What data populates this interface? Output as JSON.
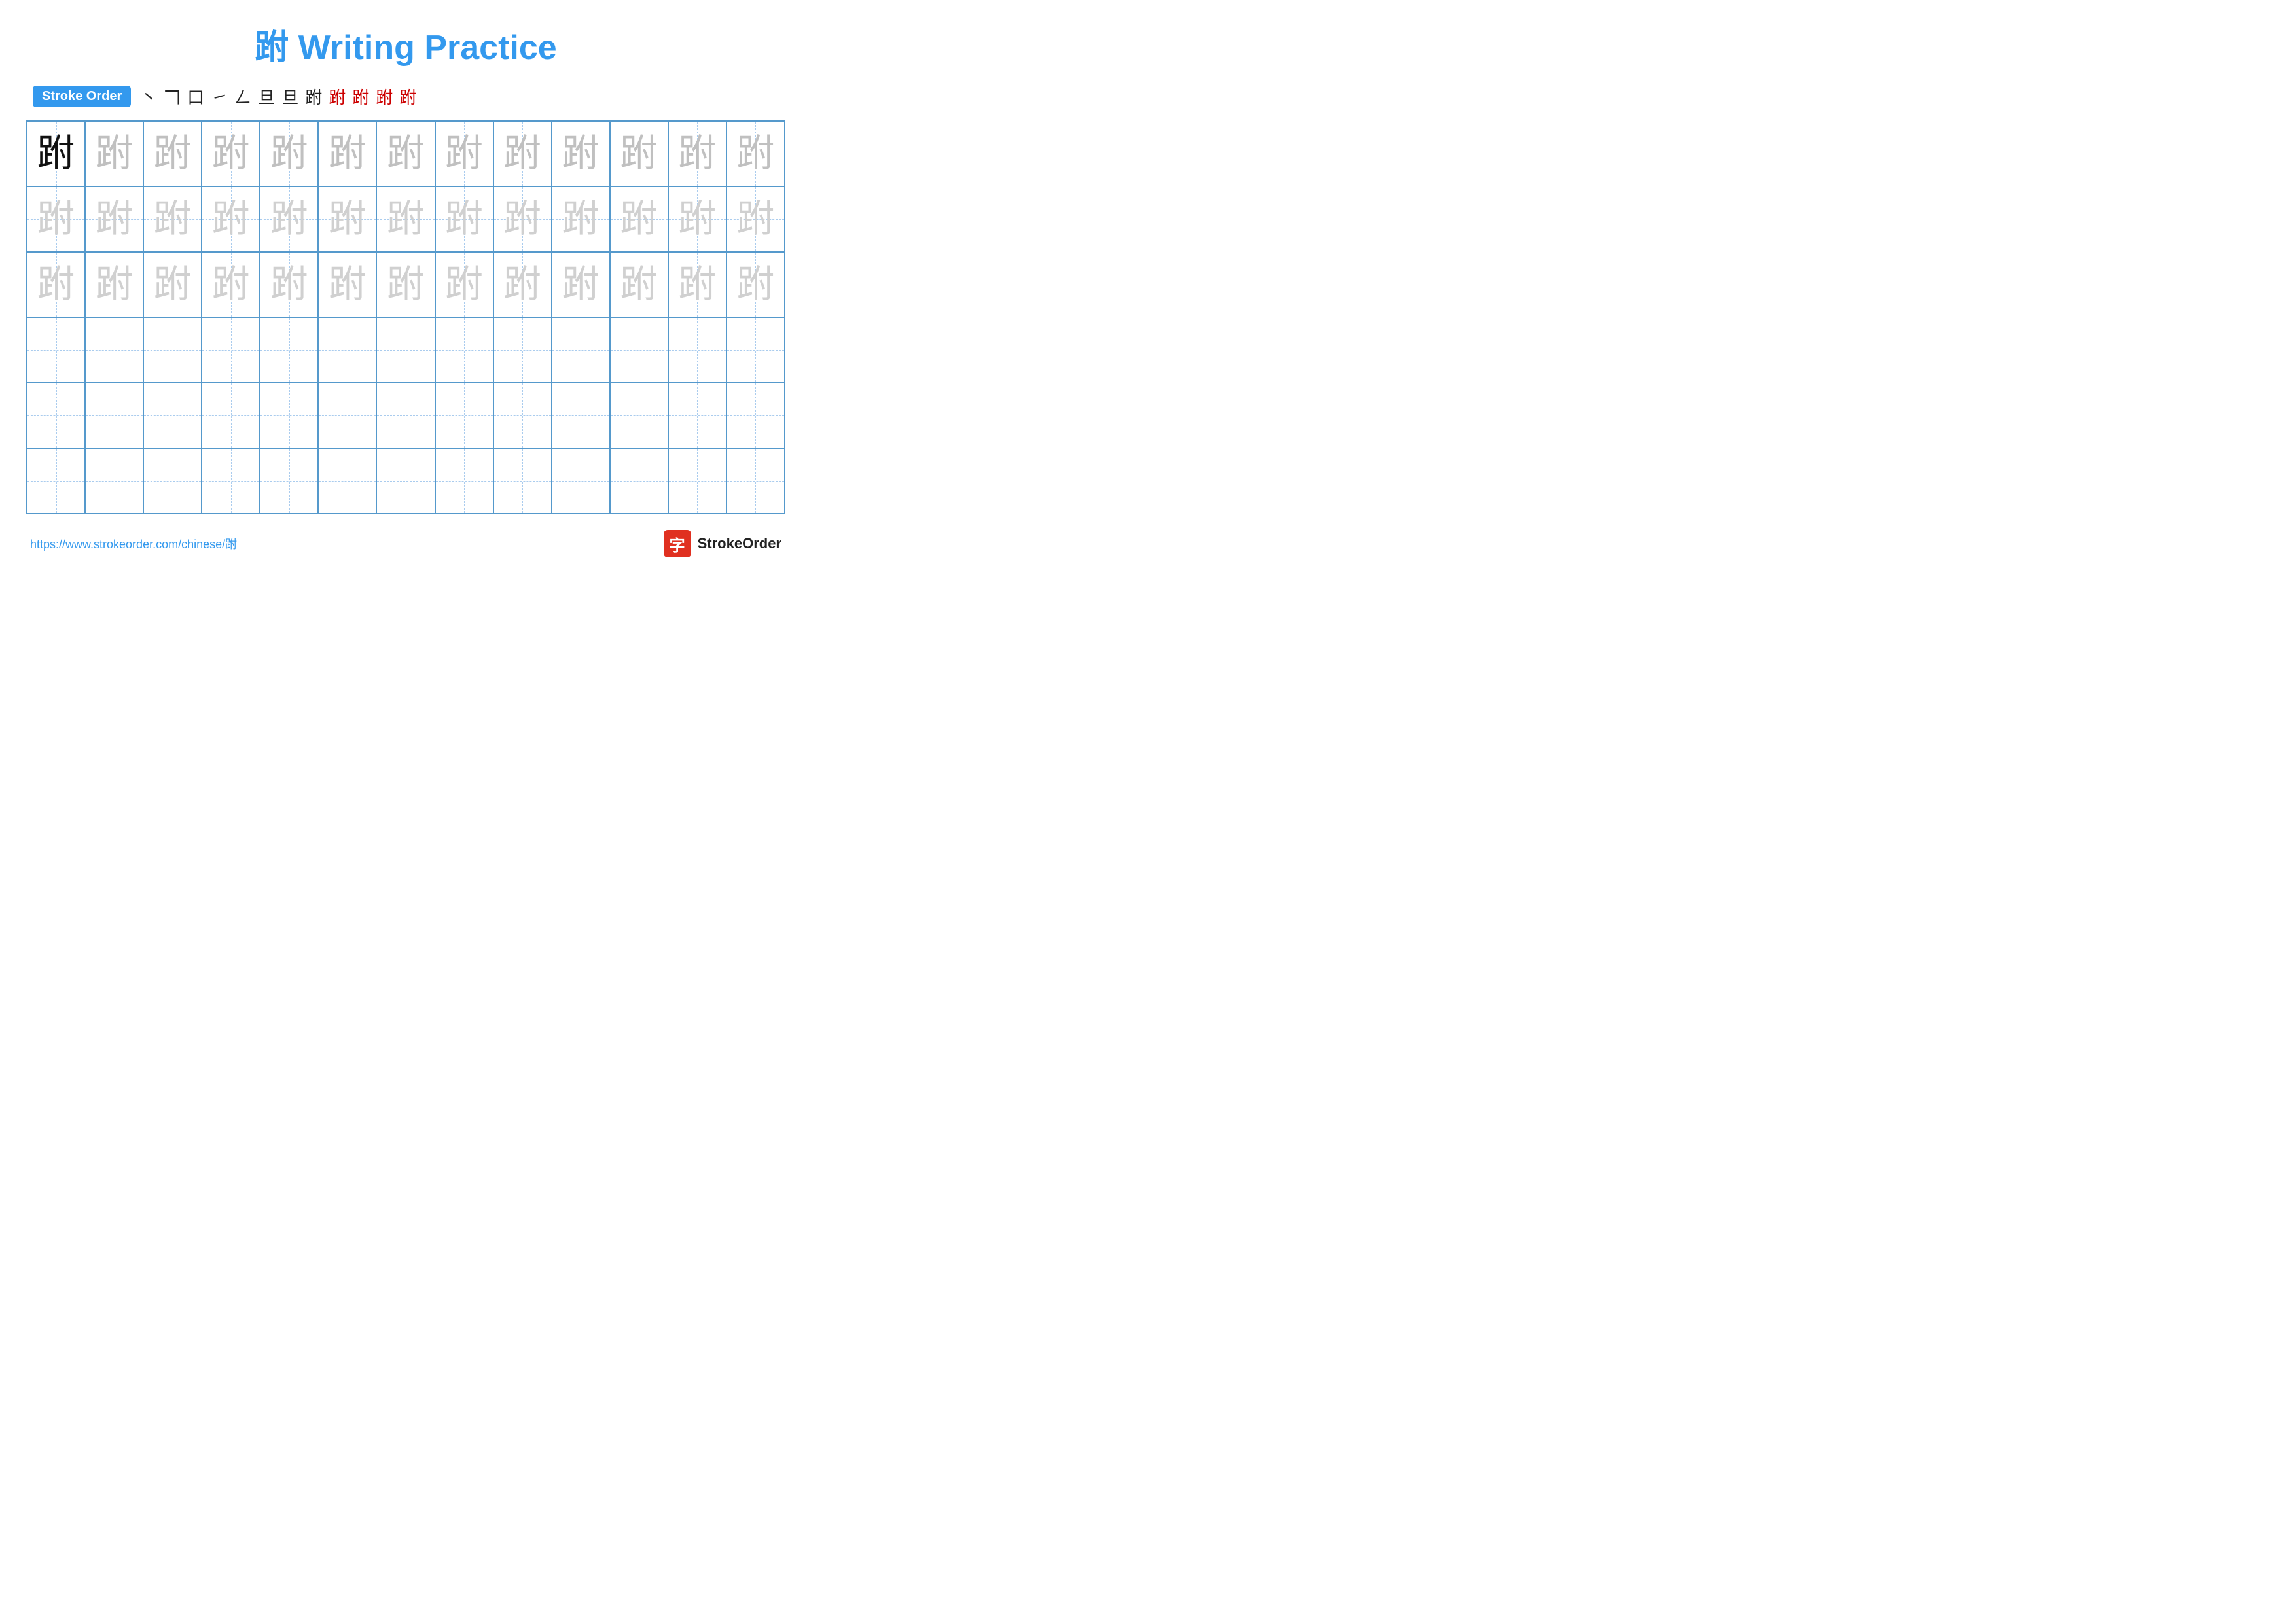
{
  "title": "跗 Writing Practice",
  "stroke_order_label": "Stroke Order",
  "stroke_steps": [
    "丶",
    "𠃍",
    "口",
    "㇀",
    "𠃋",
    "旦",
    "旦",
    "跗",
    "跗",
    "跗",
    "跗",
    "跗"
  ],
  "stroke_steps_red_from": 8,
  "character": "跗",
  "rows": [
    {
      "chars": [
        "dark",
        "gray1",
        "gray1",
        "gray1",
        "gray1",
        "gray1",
        "gray1",
        "gray1",
        "gray1",
        "gray1",
        "gray1",
        "gray1",
        "gray1"
      ]
    },
    {
      "chars": [
        "gray2",
        "gray2",
        "gray2",
        "gray2",
        "gray2",
        "gray2",
        "gray2",
        "gray2",
        "gray2",
        "gray2",
        "gray2",
        "gray2",
        "gray2"
      ]
    },
    {
      "chars": [
        "gray2",
        "gray2",
        "gray2",
        "gray2",
        "gray2",
        "gray2",
        "gray2",
        "gray2",
        "gray2",
        "gray2",
        "gray2",
        "gray2",
        "gray2"
      ]
    },
    {
      "chars": [
        "empty",
        "empty",
        "empty",
        "empty",
        "empty",
        "empty",
        "empty",
        "empty",
        "empty",
        "empty",
        "empty",
        "empty",
        "empty"
      ]
    },
    {
      "chars": [
        "empty",
        "empty",
        "empty",
        "empty",
        "empty",
        "empty",
        "empty",
        "empty",
        "empty",
        "empty",
        "empty",
        "empty",
        "empty"
      ]
    },
    {
      "chars": [
        "empty",
        "empty",
        "empty",
        "empty",
        "empty",
        "empty",
        "empty",
        "empty",
        "empty",
        "empty",
        "empty",
        "empty",
        "empty"
      ]
    }
  ],
  "footer_url": "https://www.strokeorder.com/chinese/跗",
  "footer_logo_text": "StrokeOrder"
}
